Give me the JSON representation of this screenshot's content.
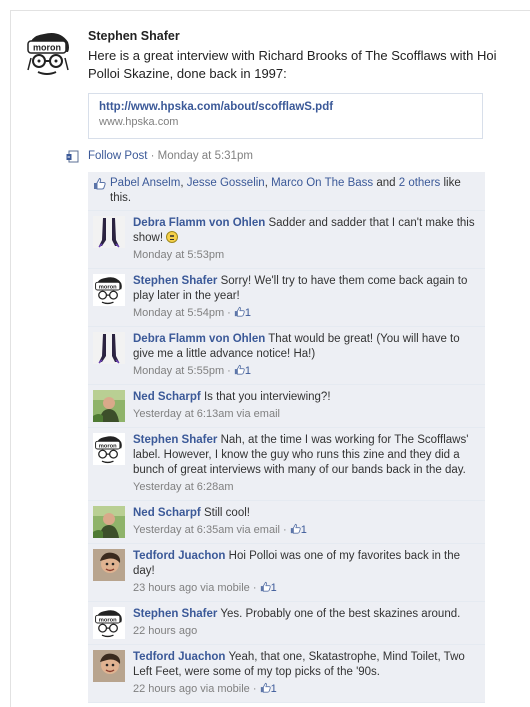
{
  "post": {
    "author": "Stephen Shafer",
    "text": "Here is a great interview with Richard Brooks of The Scofflaws with Hoi Polloi Skazine, done back in 1997:",
    "link_url": "http://www.hpska.com/about/scofflawS.pdf",
    "link_domain": "www.hpska.com",
    "follow_label": "Follow Post",
    "separator": " · ",
    "timestamp": "Monday at 5:31pm"
  },
  "likes": {
    "names": [
      "Pabel Anselm",
      "Jesse Gosselin",
      "Marco On The Bass"
    ],
    "sep1": ", ",
    "sep2": ", ",
    "and_text": " and ",
    "others_link": "2 others",
    "suffix": " like this."
  },
  "comments": [
    {
      "name": "Debra Flamm von Ohlen",
      "text": "Sadder and sadder that I can't make this show!",
      "time": "Monday at 5:53pm",
      "likes": "",
      "avatar": "boots"
    },
    {
      "name": "Stephen Shafer",
      "text": "Sorry! We'll try to have them come back again to play later in the year!",
      "time": "Monday at 5:54pm",
      "likes": "1",
      "avatar": "moron"
    },
    {
      "name": "Debra Flamm von Ohlen",
      "text": "That would be great! (You will have to give me a little advance notice! Ha!)",
      "time": "Monday at 5:55pm",
      "likes": "1",
      "avatar": "boots"
    },
    {
      "name": "Ned Scharpf",
      "text": "Is that you interviewing?!",
      "time": "Yesterday at 6:13am via email",
      "likes": "",
      "avatar": "ned"
    },
    {
      "name": "Stephen Shafer",
      "text": "Nah, at the time I was working for The Scofflaws' label. However, I know the guy who runs this zine and they did a bunch of great interviews with many of our bands back in the day.",
      "time": "Yesterday at 6:28am",
      "likes": "",
      "avatar": "moron"
    },
    {
      "name": "Ned Scharpf",
      "text": "Still cool!",
      "time": "Yesterday at 6:35am via email",
      "likes": "1",
      "avatar": "ned"
    },
    {
      "name": "Tedford Juachon",
      "text": "Hoi Polloi was one of my favorites back in the day!",
      "time": "23 hours ago via mobile",
      "likes": "1",
      "avatar": "tedford"
    },
    {
      "name": "Stephen Shafer",
      "text": "Yes. Probably one of the best skazines around.",
      "time": "22 hours ago",
      "likes": "",
      "avatar": "moron"
    },
    {
      "name": "Tedford Juachon",
      "text": "Yeah, that one, Skatastrophe, Mind Toilet, Two Left Feet, were some of my top picks of the '90s.",
      "time": "22 hours ago via mobile",
      "likes": "1",
      "avatar": "tedford"
    }
  ],
  "avatar_text": "moron",
  "colors": {
    "link": "#3b5998",
    "feedback_bg": "#edeff4",
    "meta": "#808080"
  }
}
